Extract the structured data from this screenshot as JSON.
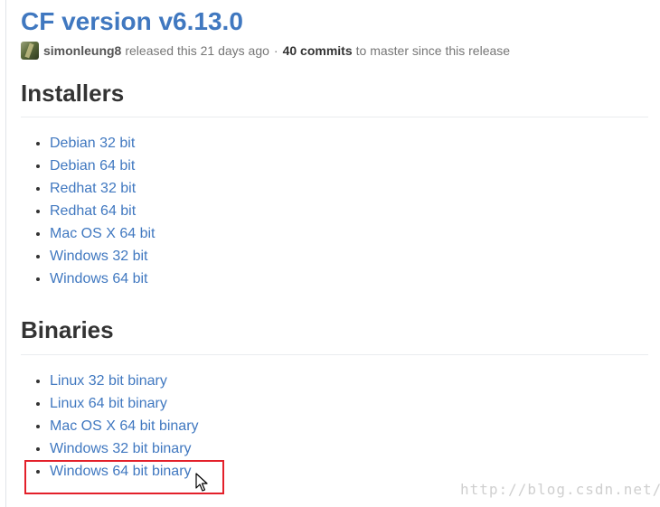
{
  "release": {
    "title": "CF version v6.13.0",
    "author": "simonleung8",
    "released_text": "released this 21 days ago",
    "separator": "·",
    "commits": "40 commits",
    "commits_suffix": "to master since this release"
  },
  "sections": {
    "installers": {
      "heading": "Installers",
      "items": [
        "Debian 32 bit",
        "Debian 64 bit",
        "Redhat 32 bit",
        "Redhat 64 bit",
        "Mac OS X 64 bit",
        "Windows 32 bit",
        "Windows 64 bit"
      ]
    },
    "binaries": {
      "heading": "Binaries",
      "items": [
        "Linux 32 bit binary",
        "Linux 64 bit binary",
        "Mac OS X 64 bit binary",
        "Windows 32 bit binary",
        "Windows 64 bit binary"
      ]
    }
  },
  "annotation": {
    "highlighted_item": "Windows 64 bit binary",
    "highlight_color": "#e3202a"
  },
  "watermark": "http://blog.csdn.net/",
  "colors": {
    "link": "#4078c0",
    "heading": "#333333",
    "meta": "#767676"
  }
}
